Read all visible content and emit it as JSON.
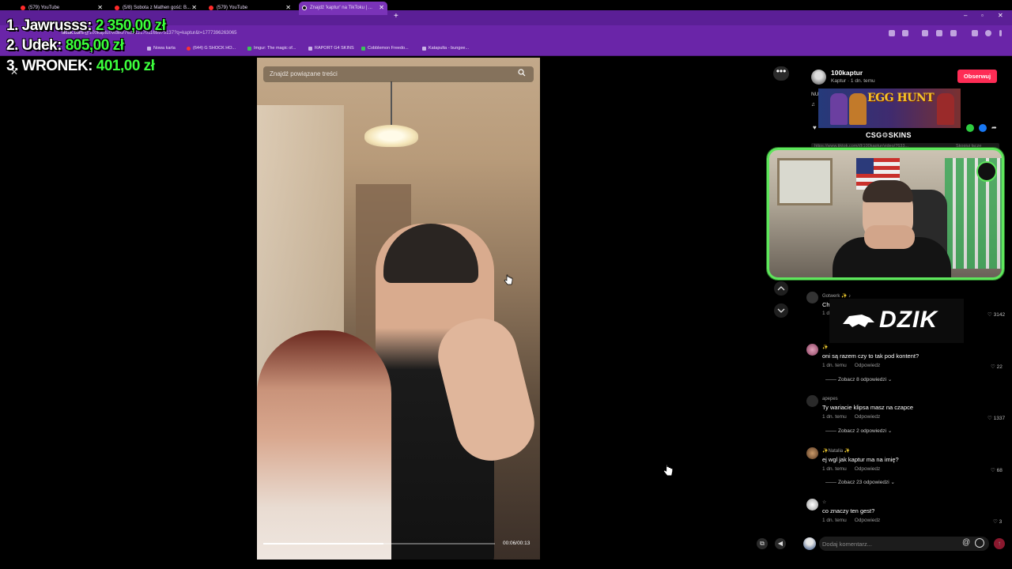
{
  "browser": {
    "tabs": [
      {
        "label": "(579) YouTube"
      },
      {
        "label": "(5/8) Sobota z Mathen gość: B..."
      },
      {
        "label": "(579) YouTube"
      },
      {
        "label": "Znajdź 'kaptur' na TikToku | ..."
      }
    ],
    "url_domain": "tiktok.com",
    "url_path": "/@100kaptur/video/7633121701168975137?q=kaptur&t=1777396263065",
    "bookmarks": [
      "Nowa karta",
      "(644) G SHOCK HO...",
      "Imgur: The magic of...",
      "RAPORT G4 SKINS",
      "Cobblemon Freedo...",
      "Katapulta - bungee..."
    ]
  },
  "overlay": {
    "leaderboard": [
      {
        "rank_name": "1. Jawrusss:",
        "amount": "2 350,00 zł"
      },
      {
        "rank_name": "2. Udek:",
        "amount": "805,00 zł"
      },
      {
        "rank_name": "3. WRONEK:",
        "amount": "401,00 zł"
      }
    ]
  },
  "video": {
    "search_placeholder": "Znajdź powiązane treści",
    "time": "00:06/00:13",
    "progress": 0.52,
    "close_glyph": "✕"
  },
  "post": {
    "author": "100kaptur",
    "meta": "Kaptur · 1 dn. temu",
    "follow_label": "Obserwuj",
    "desc_trunc": "NU",
    "music_trunc": "♫",
    "link_left": "https://www.tiktok.com/@100kaptur/video/7633...",
    "link_right": "Skopiuj łącze"
  },
  "ads": {
    "egg_hunt": "EGG HUNT",
    "csgo_skins": "CSG⚙SKINS",
    "dzik": "DZIK"
  },
  "comments": [
    {
      "user": "Gotwerk ✨ ♪",
      "text": "Ch",
      "time": "1 d",
      "reply": "",
      "likes": "3142",
      "more": ""
    },
    {
      "user": "✨",
      "text": "oni są razem czy to tak pod kontent?",
      "time": "1 dn. temu",
      "reply": "Odpowiedz",
      "likes": "22",
      "more": "Zobacz 8 odpowiedzi"
    },
    {
      "user": "apepes",
      "text": "Ty wariacie klipsa masz na czapce",
      "time": "1 dn. temu",
      "reply": "Odpowiedz",
      "likes": "1337",
      "more": "Zobacz 2 odpowiedzi"
    },
    {
      "user": "✨Natalia ✨",
      "text": "ej wgl jak kaptur ma na imię?",
      "time": "1 dn. temu",
      "reply": "Odpowiedz",
      "likes": "68",
      "more": "Zobacz 23 odpowiedzi"
    },
    {
      "user": "☆",
      "text": "co znaczy ten gest?",
      "time": "1 dn. temu",
      "reply": "Odpowiedz",
      "likes": "3",
      "more": ""
    }
  ],
  "comment_bar": {
    "placeholder": "Dodaj komentarz...",
    "at": "@"
  },
  "colors": {
    "browser_purple": "#6a25a8",
    "tiktok_red": "#fe2c55",
    "leader_green": "#3cff3c",
    "webcam_border": "#5ee65c"
  }
}
